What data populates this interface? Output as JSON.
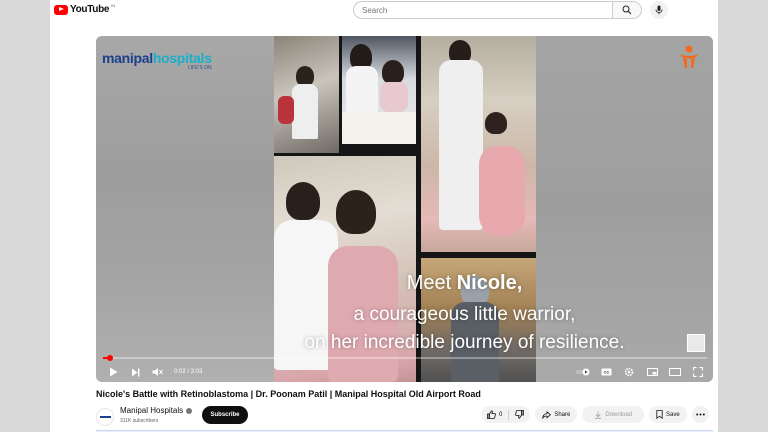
{
  "header": {
    "logo_text": "YouTube",
    "logo_country": "IN",
    "search_placeholder": "Search",
    "icons": [
      "search-icon",
      "mic-icon"
    ]
  },
  "player": {
    "brand": {
      "name_part1": "manipal",
      "name_part2": "hospitals",
      "tagline": "LIFE'S ON",
      "mark_icon": "manipal-flame-icon"
    },
    "captions": {
      "line1_pre": "Meet ",
      "line1_bold": "Nicole,",
      "line2": "a courageous little warrior,",
      "line3": "on her incredible journey of resilience."
    },
    "time_display": "0:02 / 3:03",
    "progress": 0.011,
    "controls_left": [
      "play-icon",
      "next-icon",
      "mute-icon"
    ],
    "controls_right": [
      "autoplay-toggle-icon",
      "captions-icon",
      "settings-icon",
      "miniplayer-icon",
      "theater-icon",
      "fullscreen-icon"
    ],
    "colors": {
      "progress": "#ff0000",
      "brand_blue": "#1b3f8b",
      "brand_teal": "#19b0c7",
      "brand_orange": "#f26a1b"
    }
  },
  "video": {
    "title": "Nicole's Battle with Retinoblastoma | Dr. Poonam Patil | Manipal Hospital Old Airport Road"
  },
  "channel": {
    "name": "Manipal Hospitals",
    "subscribers": "311K subscribers",
    "subscribe_label": "Subscribe"
  },
  "actions": {
    "like_count": "0",
    "share_label": "Share",
    "download_label": "Download",
    "save_label": "Save"
  }
}
